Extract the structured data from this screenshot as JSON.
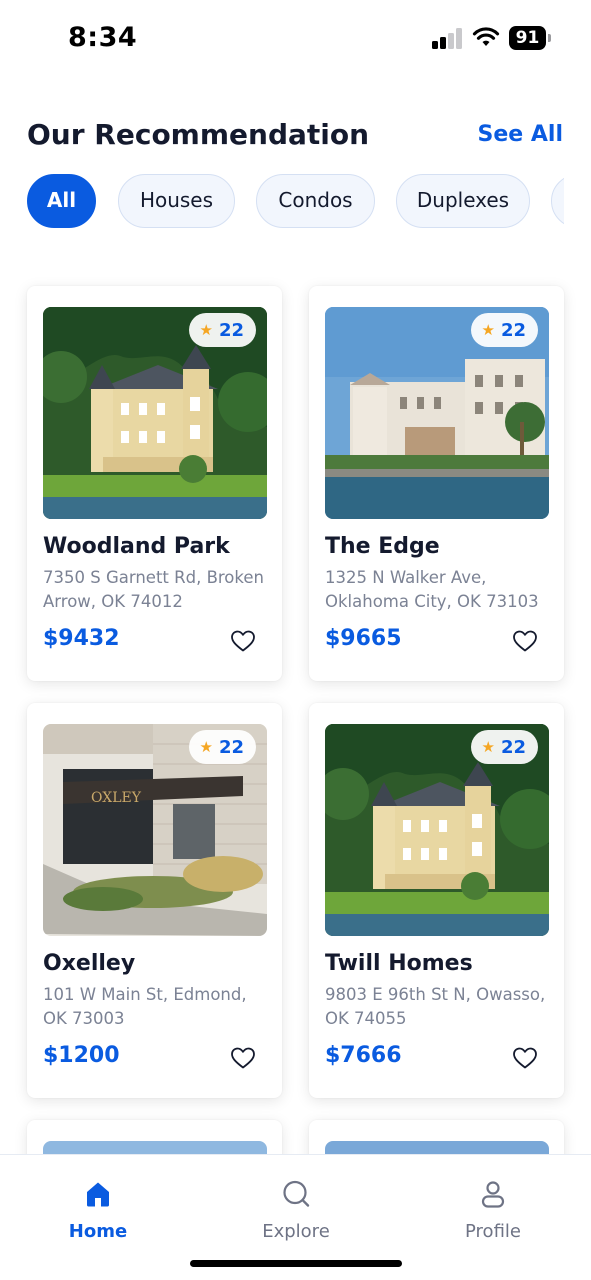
{
  "status_bar": {
    "time": "8:34",
    "battery": "91"
  },
  "header": {
    "title": "Our Recommendation",
    "see_all": "See All"
  },
  "filters": [
    {
      "label": "All",
      "active": true
    },
    {
      "label": "Houses",
      "active": false
    },
    {
      "label": "Condos",
      "active": false
    },
    {
      "label": "Duplexes",
      "active": false
    },
    {
      "label": "",
      "active": false
    }
  ],
  "listings": [
    {
      "name": "Woodland Park",
      "address": "7350 S Garnett Rd, Broken Arrow, OK 74012",
      "price": "$9432",
      "rating": "22",
      "image": "lakeside-villa"
    },
    {
      "name": "The Edge",
      "address": "1325 N Walker Ave, Oklahoma City, OK 73103",
      "price": "$9665",
      "rating": "22",
      "image": "waterfront-palace"
    },
    {
      "name": "Oxelley",
      "address": "101 W Main St, Edmond, OK 73003",
      "price": "$1200",
      "rating": "22",
      "image": "modern-building",
      "sign": "OXLEY"
    },
    {
      "name": "Twill Homes",
      "address": "9803 E 96th St N, Owasso, OK 74055",
      "price": "$7666",
      "rating": "22",
      "image": "lakeside-villa"
    }
  ],
  "bottom_nav": [
    {
      "label": "Home",
      "icon": "home-icon",
      "active": true
    },
    {
      "label": "Explore",
      "icon": "search-icon",
      "active": false
    },
    {
      "label": "Profile",
      "icon": "user-icon",
      "active": false
    }
  ],
  "colors": {
    "accent": "#0a5be0",
    "star": "#f5a623",
    "title": "#141a2e",
    "muted": "#7b8294"
  }
}
